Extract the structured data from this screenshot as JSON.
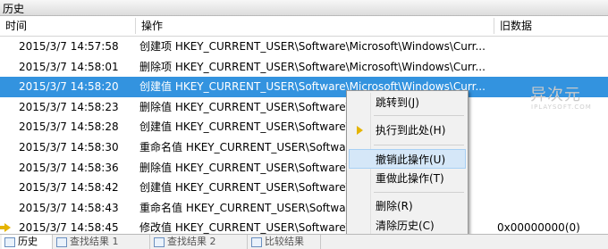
{
  "window_title": "历史",
  "columns": {
    "time": "时间",
    "operation": "操作",
    "old_data": "旧数据"
  },
  "rows": [
    {
      "time": "2015/3/7 14:57:58",
      "op": "创建项 HKEY_CURRENT_USER\\Software\\Microsoft\\Windows\\Curr...",
      "old": "",
      "selected": false,
      "current": false
    },
    {
      "time": "2015/3/7 14:58:01",
      "op": "删除项 HKEY_CURRENT_USER\\Software\\Microsoft\\Windows\\Curr...",
      "old": "",
      "selected": false,
      "current": false
    },
    {
      "time": "2015/3/7 14:58:20",
      "op": "创建值 HKEY_CURRENT_USER\\Software\\Microsoft\\Windows\\Curr...",
      "old": "",
      "selected": true,
      "current": false
    },
    {
      "time": "2015/3/7 14:58:23",
      "op": "删除值 HKEY_CURRENT_USER\\Software\\M",
      "old": "",
      "selected": false,
      "current": false
    },
    {
      "time": "2015/3/7 14:58:28",
      "op": "创建值 HKEY_CURRENT_USER\\Software\\M",
      "old": "",
      "selected": false,
      "current": false
    },
    {
      "time": "2015/3/7 14:58:30",
      "op": "重命名值 HKEY_CURRENT_USER\\Software",
      "old": "",
      "selected": false,
      "current": false
    },
    {
      "time": "2015/3/7 14:58:36",
      "op": "删除值 HKEY_CURRENT_USER\\Software\\M",
      "old": "",
      "selected": false,
      "current": false
    },
    {
      "time": "2015/3/7 14:58:42",
      "op": "创建值 HKEY_CURRENT_USER\\Software\\M",
      "old": "",
      "selected": false,
      "current": false
    },
    {
      "time": "2015/3/7 14:58:43",
      "op": "重命名值 HKEY_CURRENT_USER\\Software",
      "old": "",
      "selected": false,
      "current": false
    },
    {
      "time": "2015/3/7 14:58:45",
      "op": "修改值 HKEY_CURRENT_USER\\Software\\M",
      "old": "0x00000000(0)",
      "selected": false,
      "current": true
    }
  ],
  "context_menu": {
    "jump": "跳转到(J)",
    "execute_to_here": "执行到此处(H)",
    "undo_this": "撤销此操作(U)",
    "redo_this": "重做此操作(T)",
    "delete": "删除(R)",
    "clear_history": "清除历史(C)"
  },
  "watermark": {
    "main": "异次元",
    "sub": "IPLAYSOFT.COM"
  },
  "tabs": [
    {
      "label": "历史",
      "active": true
    },
    {
      "label": "查找结果 1",
      "active": false
    },
    {
      "label": "查找结果 2",
      "active": false
    },
    {
      "label": "比较结果",
      "active": false
    }
  ],
  "colors": {
    "selection": "#3393df",
    "menu_highlight": "#d5e7f8",
    "arrow": "#e5b400"
  }
}
